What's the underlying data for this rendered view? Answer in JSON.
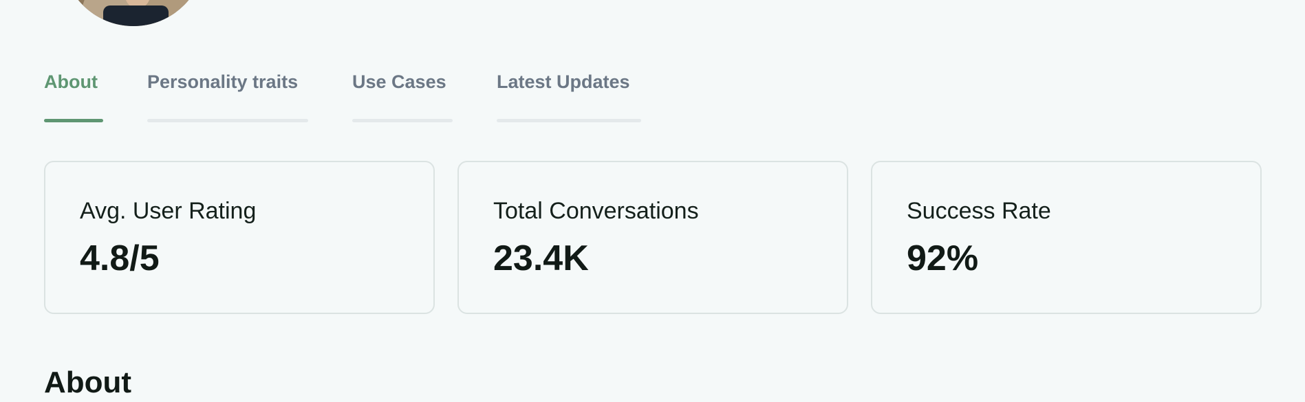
{
  "tabs": [
    {
      "label": "About",
      "active": true
    },
    {
      "label": "Personality traits",
      "active": false
    },
    {
      "label": "Use Cases",
      "active": false
    },
    {
      "label": "Latest Updates",
      "active": false
    }
  ],
  "stats": [
    {
      "label": "Avg. User Rating",
      "value": "4.8/5"
    },
    {
      "label": "Total Conversations",
      "value": "23.4K"
    },
    {
      "label": "Success Rate",
      "value": "92%"
    }
  ],
  "section": {
    "title": "About"
  },
  "colors": {
    "accent": "#5e9672",
    "tab_inactive": "#6b7785",
    "background": "#f5f9f9",
    "card_border": "#dbe3e2"
  }
}
